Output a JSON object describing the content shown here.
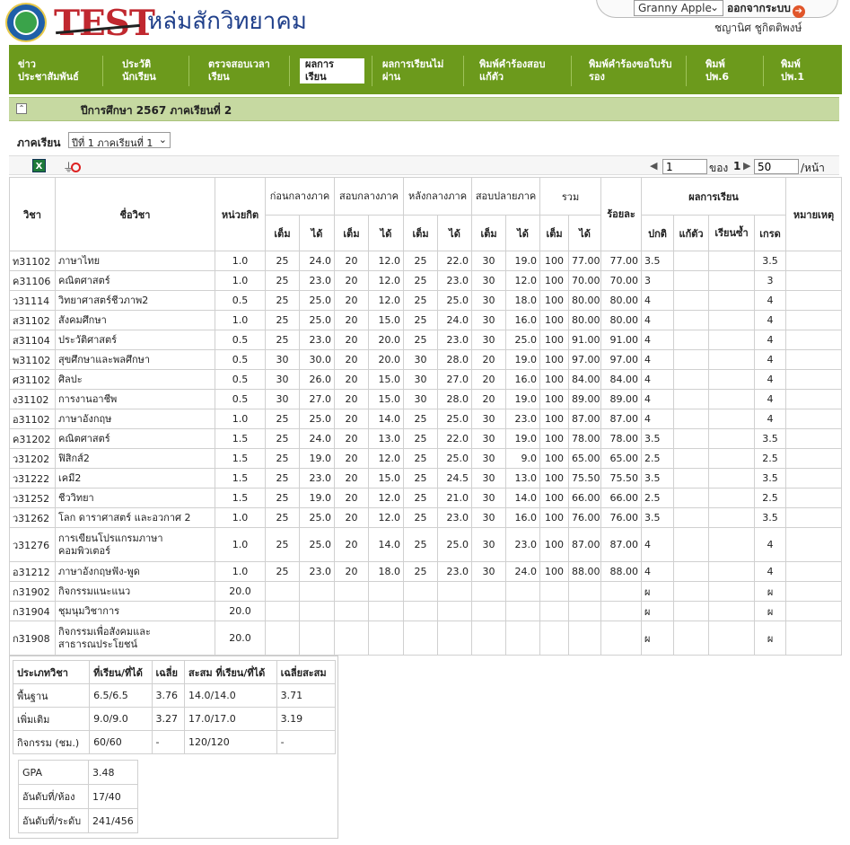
{
  "header": {
    "logo_text": "TEST",
    "school_name": "หล่มสักวิทยาคม",
    "theme_select": "Granny Apple",
    "logout_label": "ออกจากระบบ",
    "user_name": "ชญานิศ ชูกิตติพงษ์"
  },
  "nav": [
    {
      "l1": "ข่าว",
      "l2": "ประชาสัมพันธ์"
    },
    {
      "l1": "ประวัติ",
      "l2": "นักเรียน"
    },
    {
      "l1": "ตรวจสอบเวลา",
      "l2": "เรียน"
    },
    {
      "l1": "ผลการ",
      "l2": "เรียน"
    },
    {
      "l1": "ผลการเรียนไม่",
      "l2": "ผ่าน"
    },
    {
      "l1": "พิมพ์คำร้องสอบ",
      "l2": "แก้ตัว"
    },
    {
      "l1": "พิมพ์คำร้องขอใบรับ",
      "l2": "รอง"
    },
    {
      "l1": "พิมพ์",
      "l2": "ปพ.6"
    },
    {
      "l1": "พิมพ์",
      "l2": "ปพ.1"
    }
  ],
  "year_bar": "ปีการศึกษา 2567 ภาคเรียนที่ 2",
  "term": {
    "label": "ภาคเรียน",
    "selected": "ปีที่ 1 ภาคเรียนที่ 1"
  },
  "pager": {
    "page": "1",
    "of_label": "ของ",
    "total": "1",
    "per_page": "50",
    "per_label": "/หน้า"
  },
  "table": {
    "h_subject_code": "วิชา",
    "h_subject_name": "ชื่อวิชา",
    "h_credit": "หน่วยกิต",
    "h_mid_before": "ก่อนกลางภาค",
    "h_mid": "สอบกลางภาค",
    "h_after_mid": "หลังกลางภาค",
    "h_final": "สอบปลายภาค",
    "h_total": "รวม",
    "h_percent": "ร้อยละ",
    "h_result": "ผลการเรียน",
    "h_note": "หมายเหตุ",
    "h_full": "เต็ม",
    "h_got": "ได้",
    "h_normal": "ปกติ",
    "h_fix": "แก้ตัว",
    "h_repeat": "เรียนซ้ำ",
    "h_grade": "เกรด",
    "rows": [
      [
        "ท31102",
        "ภาษาไทย",
        "1.0",
        "25",
        "24.0",
        "20",
        "12.0",
        "25",
        "22.0",
        "30",
        "19.0",
        "100",
        "77.00",
        "77.00",
        "3.5",
        "",
        "",
        "3.5",
        ""
      ],
      [
        "ค31106",
        "คณิตศาสตร์",
        "1.0",
        "25",
        "23.0",
        "20",
        "12.0",
        "25",
        "23.0",
        "30",
        "12.0",
        "100",
        "70.00",
        "70.00",
        "3",
        "",
        "",
        "3",
        ""
      ],
      [
        "ว31114",
        "วิทยาศาสตร์ชีวภาพ2",
        "0.5",
        "25",
        "25.0",
        "20",
        "12.0",
        "25",
        "25.0",
        "30",
        "18.0",
        "100",
        "80.00",
        "80.00",
        "4",
        "",
        "",
        "4",
        ""
      ],
      [
        "ส31102",
        "สังคมศึกษา",
        "1.0",
        "25",
        "25.0",
        "20",
        "15.0",
        "25",
        "24.0",
        "30",
        "16.0",
        "100",
        "80.00",
        "80.00",
        "4",
        "",
        "",
        "4",
        ""
      ],
      [
        "ส31104",
        "ประวัติศาสตร์",
        "0.5",
        "25",
        "23.0",
        "20",
        "20.0",
        "25",
        "23.0",
        "30",
        "25.0",
        "100",
        "91.00",
        "91.00",
        "4",
        "",
        "",
        "4",
        ""
      ],
      [
        "พ31102",
        "สุขศึกษาและพลศึกษา",
        "0.5",
        "30",
        "30.0",
        "20",
        "20.0",
        "30",
        "28.0",
        "20",
        "19.0",
        "100",
        "97.00",
        "97.00",
        "4",
        "",
        "",
        "4",
        ""
      ],
      [
        "ศ31102",
        "ศิลปะ",
        "0.5",
        "30",
        "26.0",
        "20",
        "15.0",
        "30",
        "27.0",
        "20",
        "16.0",
        "100",
        "84.00",
        "84.00",
        "4",
        "",
        "",
        "4",
        ""
      ],
      [
        "ง31102",
        "การงานอาชีพ",
        "0.5",
        "30",
        "27.0",
        "20",
        "15.0",
        "30",
        "28.0",
        "20",
        "19.0",
        "100",
        "89.00",
        "89.00",
        "4",
        "",
        "",
        "4",
        ""
      ],
      [
        "อ31102",
        "ภาษาอังกฤษ",
        "1.0",
        "25",
        "25.0",
        "20",
        "14.0",
        "25",
        "25.0",
        "30",
        "23.0",
        "100",
        "87.00",
        "87.00",
        "4",
        "",
        "",
        "4",
        ""
      ],
      [
        "ค31202",
        "คณิตศาสตร์",
        "1.5",
        "25",
        "24.0",
        "20",
        "13.0",
        "25",
        "22.0",
        "30",
        "19.0",
        "100",
        "78.00",
        "78.00",
        "3.5",
        "",
        "",
        "3.5",
        ""
      ],
      [
        "ว31202",
        "ฟิสิกส์2",
        "1.5",
        "25",
        "19.0",
        "20",
        "12.0",
        "25",
        "25.0",
        "30",
        "9.0",
        "100",
        "65.00",
        "65.00",
        "2.5",
        "",
        "",
        "2.5",
        ""
      ],
      [
        "ว31222",
        "เคมี2",
        "1.5",
        "25",
        "23.0",
        "20",
        "15.0",
        "25",
        "24.5",
        "30",
        "13.0",
        "100",
        "75.50",
        "75.50",
        "3.5",
        "",
        "",
        "3.5",
        ""
      ],
      [
        "ว31252",
        "ชีววิทยา",
        "1.5",
        "25",
        "19.0",
        "20",
        "12.0",
        "25",
        "21.0",
        "30",
        "14.0",
        "100",
        "66.00",
        "66.00",
        "2.5",
        "",
        "",
        "2.5",
        ""
      ],
      [
        "ว31262",
        "โลก ดาราศาสตร์ และอวกาศ 2",
        "1.0",
        "25",
        "25.0",
        "20",
        "12.0",
        "25",
        "23.0",
        "30",
        "16.0",
        "100",
        "76.00",
        "76.00",
        "3.5",
        "",
        "",
        "3.5",
        ""
      ],
      [
        "ว31276",
        "การเขียนโปรแกรมภาษาคอมพิวเตอร์",
        "1.0",
        "25",
        "25.0",
        "20",
        "14.0",
        "25",
        "25.0",
        "30",
        "23.0",
        "100",
        "87.00",
        "87.00",
        "4",
        "",
        "",
        "4",
        ""
      ],
      [
        "อ31212",
        "ภาษาอังกฤษฟัง-พูด",
        "1.0",
        "25",
        "23.0",
        "20",
        "18.0",
        "25",
        "23.0",
        "30",
        "24.0",
        "100",
        "88.00",
        "88.00",
        "4",
        "",
        "",
        "4",
        ""
      ],
      [
        "ก31902",
        "กิจกรรมแนะแนว",
        "20.0",
        "",
        "",
        "",
        "",
        "",
        "",
        "",
        "",
        "",
        "",
        "",
        "ผ",
        "",
        "",
        "ผ",
        ""
      ],
      [
        "ก31904",
        "ชุมนุมวิชาการ",
        "20.0",
        "",
        "",
        "",
        "",
        "",
        "",
        "",
        "",
        "",
        "",
        "",
        "ผ",
        "",
        "",
        "ผ",
        ""
      ],
      [
        "ก31908",
        "กิจกรรมเพื่อสังคมและสาธารณประโยชน์",
        "20.0",
        "",
        "",
        "",
        "",
        "",
        "",
        "",
        "",
        "",
        "",
        "",
        "ผ",
        "",
        "",
        "ผ",
        ""
      ]
    ]
  },
  "summary": {
    "headers": [
      "ประเภทวิชา",
      "ที่เรียน/ที่ได้",
      "เฉลี่ย",
      "สะสม ที่เรียน/ที่ได้",
      "เฉลี่ยสะสม"
    ],
    "rows": [
      [
        "พื้นฐาน",
        "6.5/6.5",
        "3.76",
        "14.0/14.0",
        "3.71"
      ],
      [
        "เพิ่มเติม",
        "9.0/9.0",
        "3.27",
        "17.0/17.0",
        "3.19"
      ],
      [
        "กิจกรรม (ชม.)",
        "60/60",
        "-",
        "120/120",
        "-"
      ]
    ],
    "gpa_label": "GPA",
    "gpa": "3.48",
    "rank_class_label": "อันดับที่/ห้อง",
    "rank_class": "17/40",
    "rank_level_label": "อันดับที่/ระดับ",
    "rank_level": "241/456"
  }
}
